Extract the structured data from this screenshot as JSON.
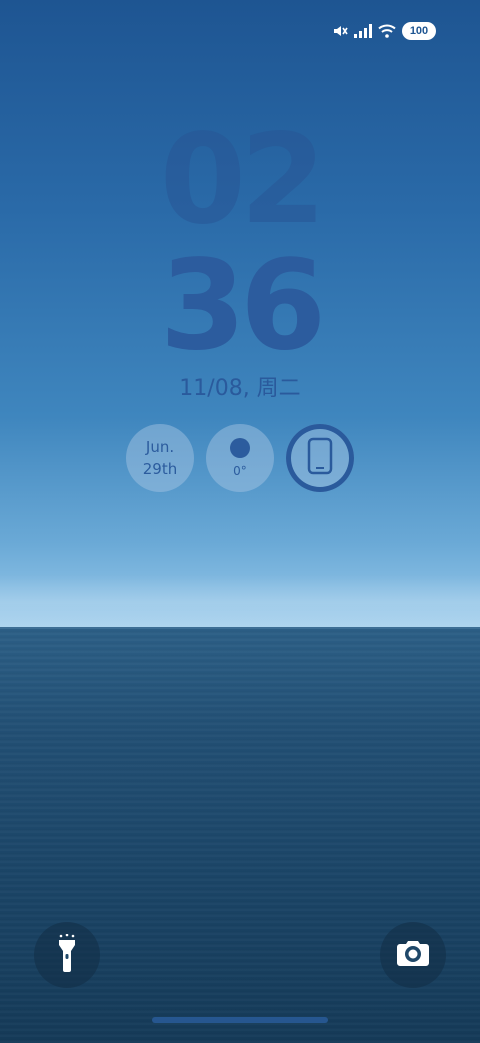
{
  "status_bar": {
    "mute_icon": "mute-icon",
    "signal_icon": "signal-icon",
    "wifi_icon": "wifi-icon",
    "battery_level": "100"
  },
  "clock": {
    "hours": "02",
    "minutes": "36"
  },
  "date": {
    "text": "11/08, 周二"
  },
  "widgets": {
    "calendar": {
      "month": "Jun.",
      "day": "29th"
    },
    "weather": {
      "temp": "0°",
      "icon": "weather-dot-icon"
    },
    "device": {
      "icon": "phone-icon"
    }
  },
  "shortcuts": {
    "flashlight_icon": "flashlight-icon",
    "camera_icon": "camera-icon"
  },
  "colors": {
    "accent": "#2c5c9e",
    "sky_top": "#1e5592",
    "sea": "#1b4567"
  }
}
